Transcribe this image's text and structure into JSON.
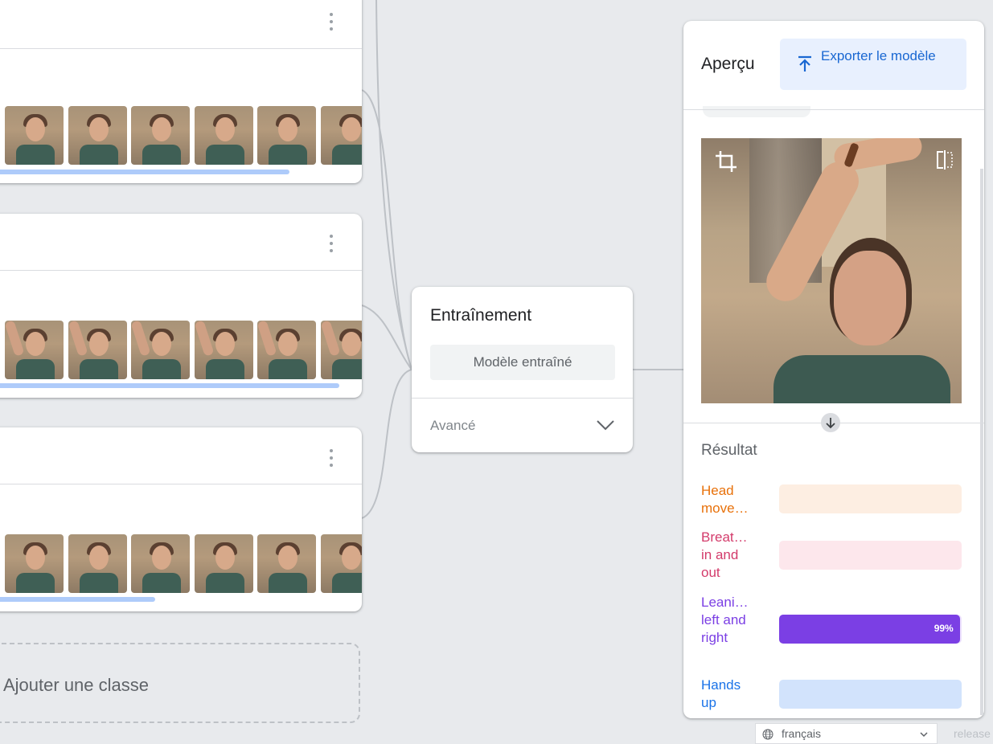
{
  "preview": {
    "title": "Aperçu",
    "export_label": "Exporter le modèle"
  },
  "training": {
    "title": "Entraînement",
    "button_label": "Modèle entraîné",
    "advanced_label": "Avancé"
  },
  "add_class_label": "Ajouter une classe",
  "result": {
    "title": "Résultat",
    "rows": [
      {
        "label": "Head move…",
        "percent": 0,
        "color": "#e8710a",
        "bg": "#fdeee2",
        "pct_label": ""
      },
      {
        "label": "Breat… in and out",
        "percent": 0,
        "color": "#d33b6b",
        "bg": "#fde7ec",
        "pct_label": ""
      },
      {
        "label": "Leani… left and right",
        "percent": 99,
        "color": "#7b3fe4",
        "bg": "#ede2fd",
        "pct_label": "99%"
      },
      {
        "label": "Hands up",
        "percent": 0,
        "color": "#1a73e8",
        "bg": "#d2e3fc",
        "pct_label": ""
      }
    ]
  },
  "language": {
    "selected": "français"
  },
  "footer_text": "release",
  "icons": [
    "more-vert-icon",
    "upload-icon",
    "chevron-down-icon",
    "crop-icon",
    "flip-icon",
    "arrow-down-icon",
    "globe-icon"
  ]
}
